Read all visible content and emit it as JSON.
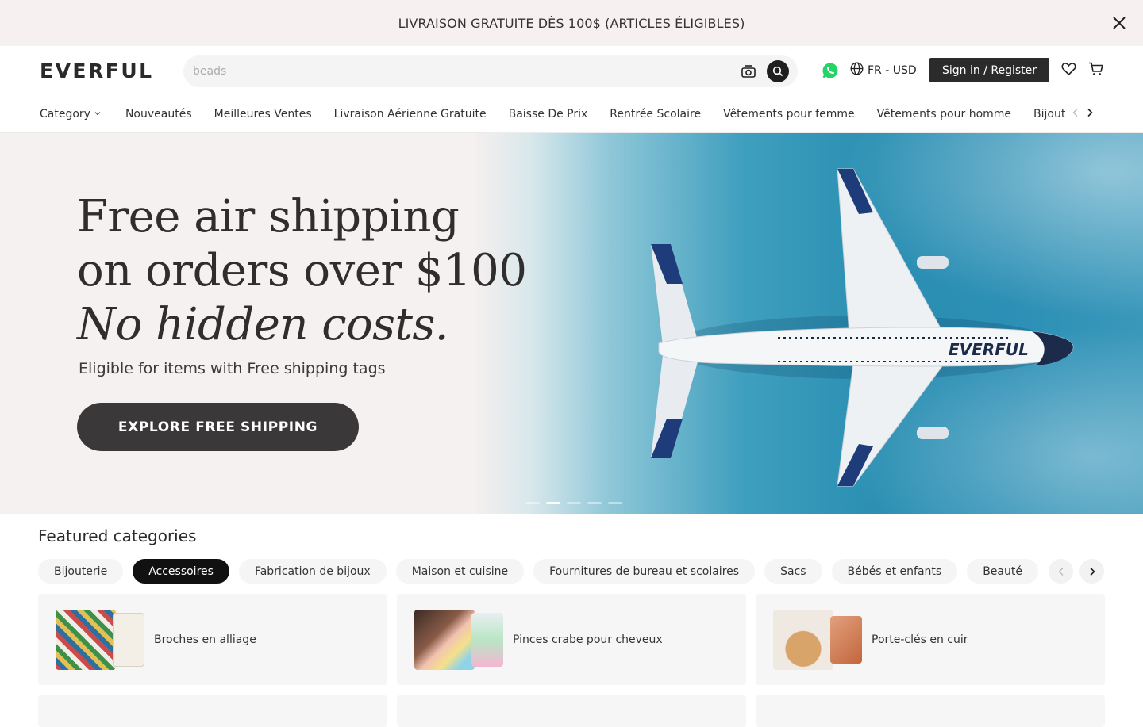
{
  "announcement": {
    "text": "LIVRAISON GRATUITE DÈS 100$ (ARTICLES ÉLIGIBLES)"
  },
  "header": {
    "logo": "EVERFUL",
    "search_placeholder": "beads",
    "language": "FR - USD",
    "signin_label": "Sign in / Register"
  },
  "nav": {
    "category_label": "Category",
    "items": [
      "Nouveautés",
      "Meilleures Ventes",
      "Livraison Aérienne Gratuite",
      "Baisse De Prix",
      "Rentrée Scolaire",
      "Vêtements pour femme",
      "Vêtements pour homme",
      "Bijout"
    ]
  },
  "hero": {
    "line1": "Free air shipping",
    "line2": "on orders over $100",
    "line3": "No hidden costs.",
    "subtitle": "Eligible for items with Free shipping tags",
    "cta": "EXPLORE FREE SHIPPING",
    "plane_text": "EVERFUL",
    "slides": 5,
    "active_slide": 2
  },
  "featured": {
    "title": "Featured categories",
    "chips": [
      "Bijouterie",
      "Accessoires",
      "Fabrication de bijoux",
      "Maison et cuisine",
      "Fournitures de bureau et scolaires",
      "Sacs",
      "Bébés et enfants",
      "Beauté"
    ],
    "active_chip": "Accessoires",
    "cards": [
      {
        "label": "Broches en alliage"
      },
      {
        "label": "Pinces crabe pour cheveux"
      },
      {
        "label": "Porte-clés en cuir"
      }
    ]
  },
  "colors": {
    "dark": "#2b2b2b",
    "announce_bg": "#f6f1f0",
    "whatsapp": "#25d366",
    "sea": "#2a8fb3"
  }
}
